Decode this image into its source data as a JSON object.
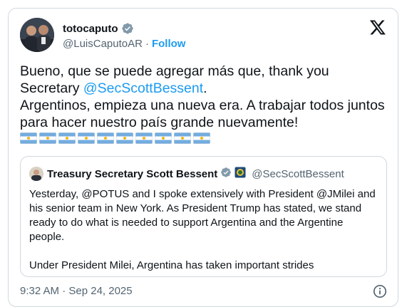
{
  "author": {
    "display_name": "totocaputo",
    "handle": "@LuisCaputoAR",
    "separator": "·",
    "follow_label": "Follow"
  },
  "tweet": {
    "line1": "Bueno, que se puede agregar más que, thank you",
    "line2_prefix": "Secretary ",
    "line2_mention": "@SecScottBessent",
    "line2_suffix": ".",
    "line3": "Argentinos, empieza una nueva era. A trabajar todos juntos para hacer nuestro país grande nuevamente!",
    "flag_emoji": "🇦🇷",
    "flag_count": 10
  },
  "quoted": {
    "display_name": "Treasury Secretary Scott Bessent",
    "handle": "@SecScottBessent",
    "text": "Yesterday, @POTUS and I spoke extensively with President @JMilei and his senior team in New York.  As President Trump has stated, we stand ready to do what is needed to support Argentina and the Argentine people.\n\nUnder President Milei, Argentina has taken important strides"
  },
  "meta": {
    "timestamp": "9:32 AM · Sep 24, 2025"
  },
  "colors": {
    "accent": "#1d9bf0",
    "text": "#0f1419",
    "muted": "#536471",
    "border": "#cfd9de",
    "gov_badge": "#829aab"
  },
  "icons": [
    "avatar",
    "verified-badge-icon",
    "x-logo-icon",
    "argentina-flag-icon",
    "government-badge-icon",
    "info-icon"
  ]
}
